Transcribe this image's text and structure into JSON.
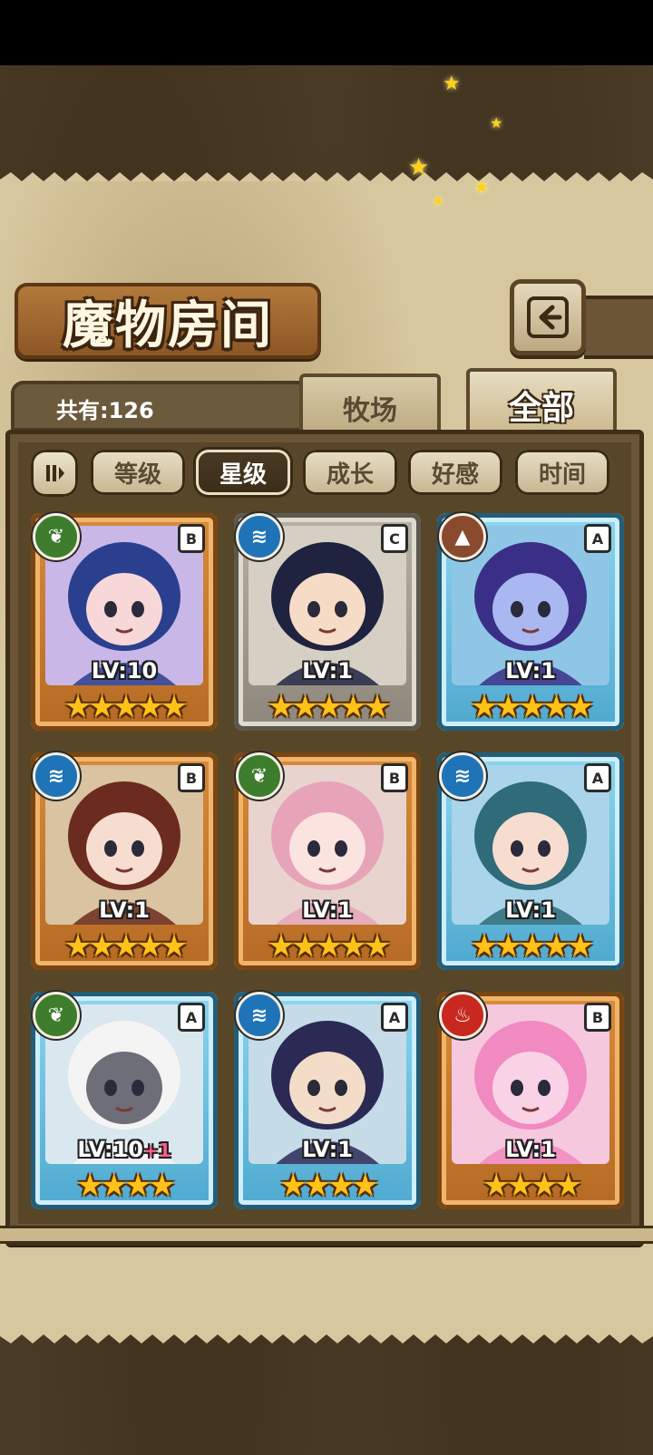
{
  "header": {
    "title": "魔物房间"
  },
  "back_button": {
    "icon": "back-arrow-icon"
  },
  "summary": {
    "count_text": "共有:126"
  },
  "tabs": [
    {
      "label": "牧场",
      "selected": false
    },
    {
      "label": "全部",
      "selected": true
    }
  ],
  "sort": {
    "toggle_icon": "sort-order-icon",
    "options": [
      {
        "label": "等级",
        "selected": false
      },
      {
        "label": "星级",
        "selected": true
      },
      {
        "label": "成长",
        "selected": false
      },
      {
        "label": "好感",
        "selected": false
      },
      {
        "label": "时间",
        "selected": false
      }
    ]
  },
  "monsters": [
    {
      "element": "wood",
      "rank": "B",
      "level": "LV:10",
      "bonus": "",
      "stars": 5,
      "frame": "orange"
    },
    {
      "element": "water",
      "rank": "C",
      "level": "LV:1",
      "bonus": "",
      "stars": 5,
      "frame": "silver"
    },
    {
      "element": "earth",
      "rank": "A",
      "level": "LV:1",
      "bonus": "",
      "stars": 5,
      "frame": "blue"
    },
    {
      "element": "water",
      "rank": "B",
      "level": "LV:1",
      "bonus": "",
      "stars": 5,
      "frame": "orange"
    },
    {
      "element": "wood",
      "rank": "B",
      "level": "LV:1",
      "bonus": "",
      "stars": 5,
      "frame": "orange"
    },
    {
      "element": "water",
      "rank": "A",
      "level": "LV:1",
      "bonus": "",
      "stars": 5,
      "frame": "blue"
    },
    {
      "element": "wood",
      "rank": "A",
      "level": "LV:10",
      "bonus": "+1",
      "stars": 4,
      "frame": "blue"
    },
    {
      "element": "water",
      "rank": "A",
      "level": "LV:1",
      "bonus": "",
      "stars": 4,
      "frame": "blue"
    },
    {
      "element": "fire",
      "rank": "B",
      "level": "LV:1",
      "bonus": "",
      "stars": 4,
      "frame": "orange"
    }
  ],
  "colors": {
    "frame_orange": "#d98b3a",
    "frame_blue": "#8cd6ef",
    "frame_silver": "#b7b1a4",
    "star": "#ffc21a"
  }
}
